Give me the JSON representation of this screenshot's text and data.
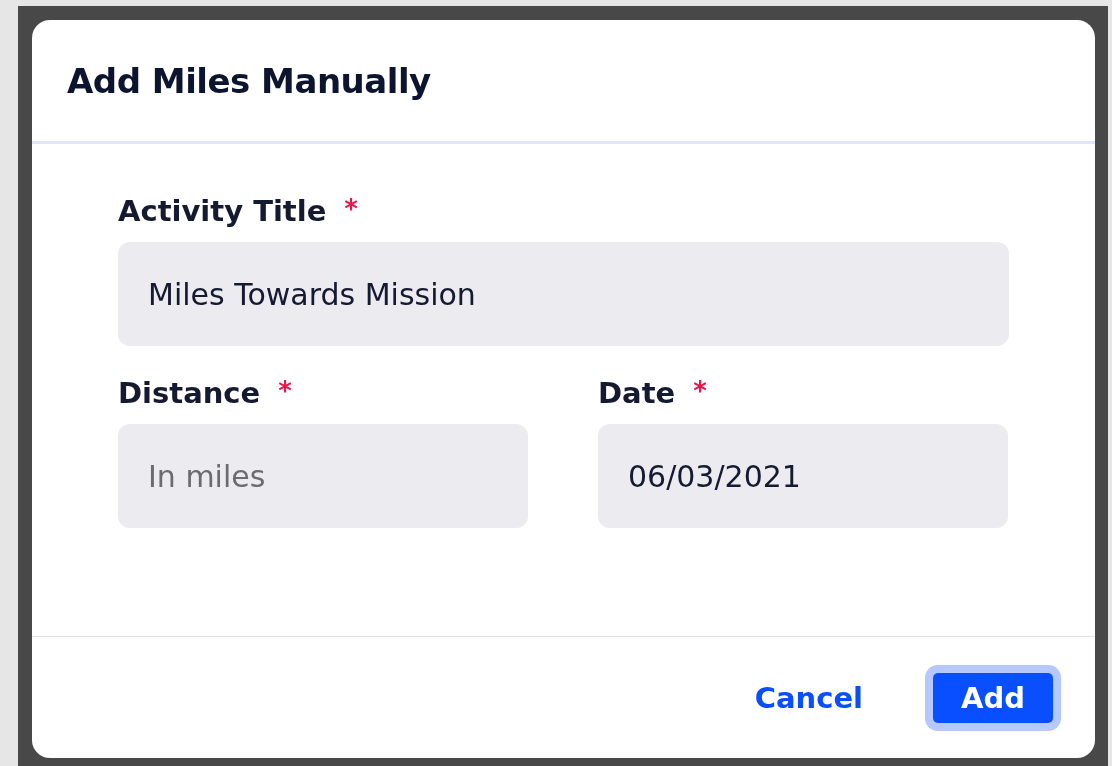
{
  "dialog": {
    "title": "Add Miles Manually",
    "fields": [
      {
        "label": "Activity Title",
        "required": true,
        "value": "Miles Towards Mission"
      },
      {
        "label": "Distance",
        "required": true,
        "placeholder": "In miles"
      },
      {
        "label": "Date",
        "required": true,
        "value": "06/03/2021"
      }
    ],
    "required_mark": "*",
    "buttons": [
      {
        "kind": "link",
        "label": "Cancel"
      },
      {
        "kind": "primary",
        "label": "Add"
      }
    ]
  }
}
